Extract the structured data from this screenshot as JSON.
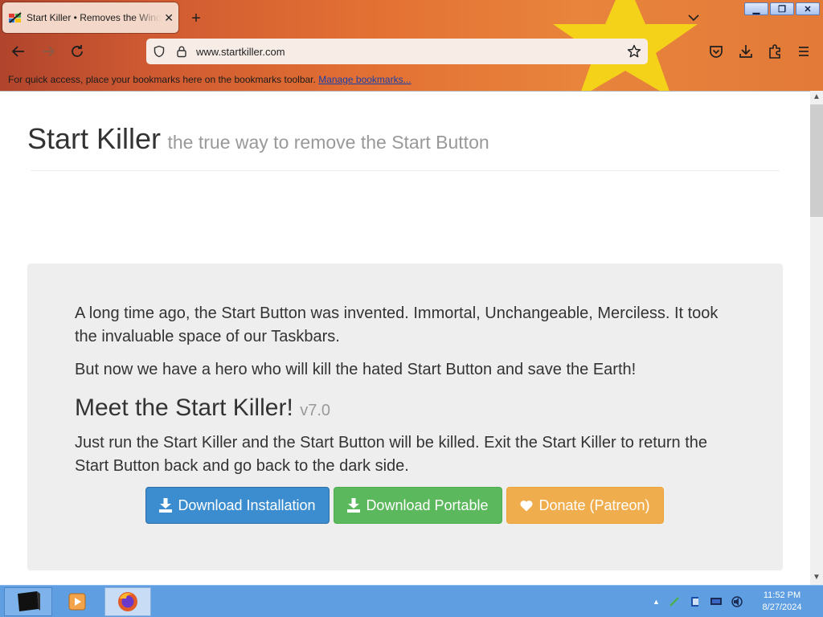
{
  "browser": {
    "tab_title": "Start Killer • Removes the Windows Start Button",
    "url": "www.startkiller.com",
    "bookmarks_message": "For quick access, place your bookmarks here on the bookmarks toolbar.",
    "manage_bookmarks_label": "Manage bookmarks..."
  },
  "page": {
    "site_title": "Start Killer",
    "site_tagline": "the true way to remove the Start Button",
    "intro": "A long time ago, the Start Button was invented. Immortal, Unchangeable, Merciless. It took the invaluable space of our Taskbars.",
    "hero": "But now we have a hero who will kill the hated Start Button and save the Earth!",
    "meet_heading": "Meet the Start Killer!",
    "version": "v7.0",
    "run_text": "Just run the Start Killer and the Start Button will be killed. Exit the Start Killer to return the Start Button back and go back to the dark side.",
    "buttons": {
      "download_installation": "Download Installation",
      "download_portable": "Download Portable",
      "donate": "Donate (Patreon)"
    }
  },
  "taskbar": {
    "time": "11:52 PM",
    "date": "8/27/2024"
  },
  "colors": {
    "primary_button": "#3c8dcf",
    "success_button": "#5cb85c",
    "warning_button": "#f0ad4e",
    "taskbar": "#5f9fe1"
  }
}
